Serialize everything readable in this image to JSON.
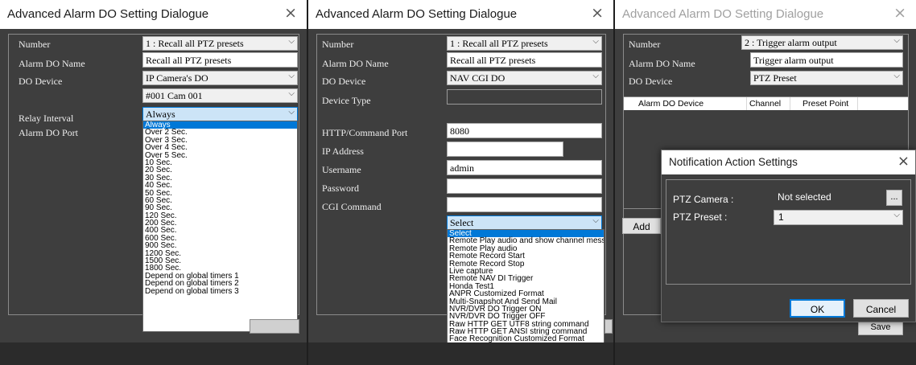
{
  "dialog_title": "Advanced Alarm DO Setting Dialogue",
  "close_glyph": "×",
  "chevron": "⌵",
  "labels": {
    "number": "Number",
    "alarm_do_name": "Alarm DO Name",
    "do_device": "DO Device",
    "relay_interval": "Relay Interval",
    "alarm_do_port": "Alarm DO Port",
    "device_type": "Device Type",
    "http_port": "HTTP/Command Port",
    "ip_address": "IP Address",
    "username": "Username",
    "password": "Password",
    "cgi_command": "CGI Command"
  },
  "panel1": {
    "number_value": "1 : Recall all PTZ presets",
    "name_value": "Recall all PTZ presets",
    "device_value": "IP Camera's DO",
    "camera_value": "#001 Cam 001",
    "relay_value": "Always",
    "relay_options": [
      "Always",
      "Over 2 Sec.",
      "Over 3 Sec.",
      "Over 4 Sec.",
      "Over 5 Sec.",
      "10 Sec.",
      "20 Sec.",
      "30 Sec.",
      "40 Sec.",
      "50 Sec.",
      "60 Sec.",
      "90 Sec.",
      "120 Sec.",
      "200 Sec.",
      "400 Sec.",
      "600 Sec.",
      "900 Sec.",
      "1200 Sec.",
      "1500 Sec.",
      "1800 Sec.",
      "Depend on global timers 1",
      "Depend on global timers 2",
      "Depend on global timers 3"
    ],
    "relay_selected_index": 0
  },
  "panel2": {
    "number_value": "1 : Recall all PTZ presets",
    "name_value": "Recall all PTZ presets",
    "device_value": "NAV CGI DO",
    "device_type_value": "",
    "http_port_value": "8080",
    "ip_value": "",
    "username_value": "admin",
    "password_value": "",
    "cgi_value": "",
    "cgi_select_value": "Select",
    "cgi_options": [
      "Select",
      "Remote Play audio and show channel message",
      "Remote Play audio",
      "Remote Record Start",
      "Remote Record Stop",
      "Live capture",
      "Remote NAV DI Trigger",
      "Honda Test1",
      "ANPR Customized Format",
      "Multi-Snapshot And Send Mail",
      "NVR/DVR DO Trigger ON",
      "NVR/DVR DO Trigger OFF",
      "Raw HTTP GET UTF8 string command",
      "Raw HTTP GET ANSI string command",
      "Face Recognition Customized Format"
    ],
    "cgi_selected_index": 0
  },
  "panel3": {
    "number_value": "2 : Trigger alarm output",
    "name_value": "Trigger alarm output",
    "device_value": "PTZ Preset",
    "table_headers": [
      "Alarm DO Device",
      "Channel",
      "Preset Point"
    ],
    "add_label": "Add",
    "save_label": "Save"
  },
  "notify": {
    "title": "Notification Action Settings",
    "ptz_camera_label": "PTZ Camera :",
    "ptz_camera_value": "Not selected",
    "browse_label": "...",
    "ptz_preset_label": "PTZ Preset :",
    "ptz_preset_value": "1",
    "ok_label": "OK",
    "cancel_label": "Cancel"
  },
  "colors": {
    "dialog_bg": "#3e3e3e",
    "highlight": "#0078d7",
    "accent_border": "#0078d7"
  }
}
